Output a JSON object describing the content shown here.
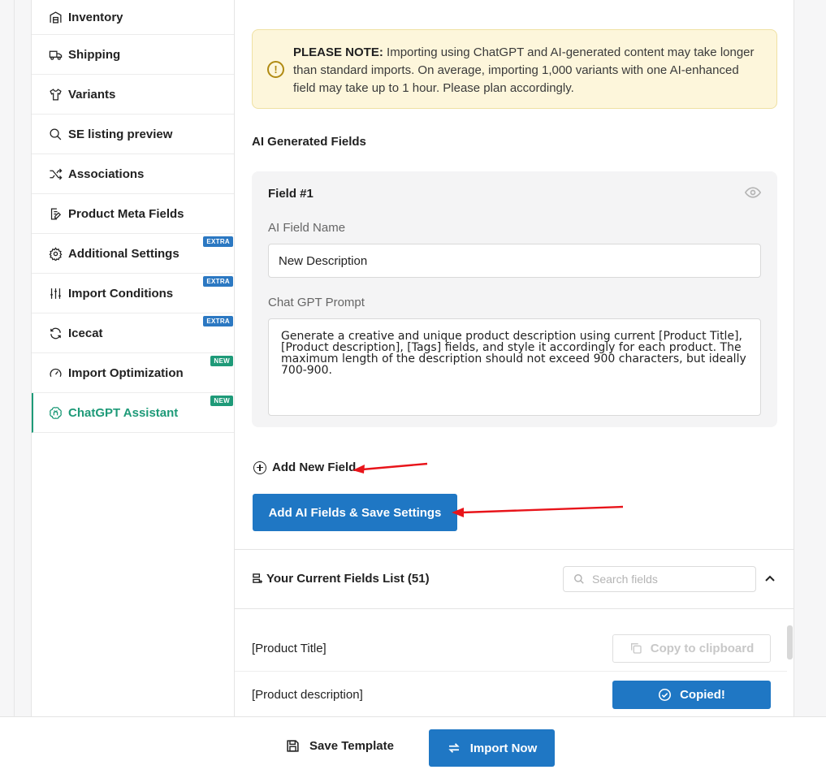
{
  "sidebar": {
    "items": [
      {
        "label": "Inventory",
        "icon": "warehouse-icon"
      },
      {
        "label": "Shipping",
        "icon": "truck-icon"
      },
      {
        "label": "Variants",
        "icon": "shirt-icon"
      },
      {
        "label": "SE listing preview",
        "icon": "search-icon"
      },
      {
        "label": "Associations",
        "icon": "shuffle-icon"
      },
      {
        "label": "Product Meta Fields",
        "icon": "document-edit-icon"
      },
      {
        "label": "Additional Settings",
        "icon": "gear-icon",
        "badge": "EXTRA"
      },
      {
        "label": "Import Conditions",
        "icon": "sliders-icon",
        "badge": "EXTRA"
      },
      {
        "label": "Icecat",
        "icon": "refresh-icon",
        "badge": "EXTRA"
      },
      {
        "label": "Import Optimization",
        "icon": "gauge-icon",
        "badge": "NEW"
      },
      {
        "label": "ChatGPT Assistant",
        "icon": "openai-icon",
        "badge": "NEW",
        "active": true
      }
    ]
  },
  "note": {
    "prefix": "PLEASE NOTE:",
    "text": " Importing using ChatGPT and AI-generated content may take longer than standard imports. On average, importing 1,000 variants with one AI-enhanced field may take up to 1 hour. Please plan accordingly."
  },
  "ai_fields": {
    "section_label": "AI Generated Fields",
    "field_title": "Field #1",
    "name_label": "AI Field Name",
    "name_value": "New Description",
    "prompt_label": "Chat GPT Prompt",
    "prompt_value": "Generate a creative and unique product description using current [Product Title], [Product description], [Tags] fields, and style it accordingly for each product. The maximum length of the description should not exceed 900 characters, but ideally 700-900."
  },
  "actions": {
    "add_field_label": "Add New Field",
    "save_label": "Add AI Fields & Save Settings"
  },
  "fields_list": {
    "title": "Your Current Fields List (51)",
    "search_placeholder": "Search fields",
    "rows": [
      {
        "name": "[Product Title]",
        "button": "Copy to clipboard",
        "state": "idle"
      },
      {
        "name": "[Product description]",
        "button": "Copied!",
        "state": "copied"
      }
    ]
  },
  "footer": {
    "save_template_label": "Save Template",
    "import_label": "Import Now"
  },
  "colors": {
    "accent_blue": "#1f77c4",
    "accent_green": "#1e9a78",
    "note_bg": "#fdf6db",
    "annotation_red": "#e8141a"
  }
}
